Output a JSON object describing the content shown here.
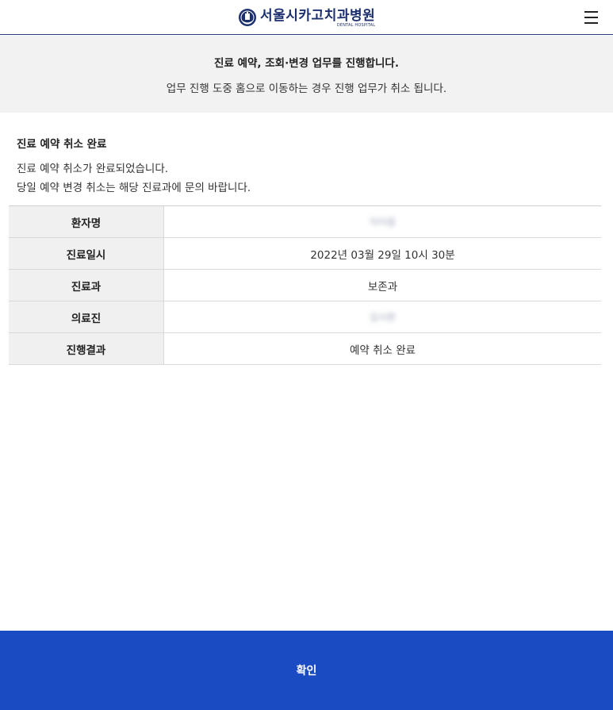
{
  "header": {
    "hospital_name": "서울시카고치과병원",
    "hospital_sub": "DENTAL HOSPITAL",
    "menu_icon": "hamburger-menu-icon"
  },
  "notice": {
    "title": "진료 예약, 조회·변경 업무를 진행합니다.",
    "subtitle": "업무 진행 도중 홈으로 이동하는 경우 진행 업무가 취소 됩니다."
  },
  "result": {
    "section_title": "진료 예약 취소 완료",
    "message_line1": "진료 예약 취소가 완료되었습니다.",
    "message_line2": "당일 예약 변경 취소는 해당 진료과에 문의 바랍니다."
  },
  "table": {
    "rows": [
      {
        "label": "환자명",
        "value": "이이응"
      },
      {
        "label": "진료일시",
        "value": "2022년 03월 29일 10시 30분"
      },
      {
        "label": "진료과",
        "value": "보존과"
      },
      {
        "label": "의료진",
        "value": "김시완"
      },
      {
        "label": "진행결과",
        "value": "예약 취소 완료"
      }
    ]
  },
  "footer": {
    "confirm_label": "확인"
  },
  "colors": {
    "brand_navy": "#1c2f6e",
    "confirm_button": "#1b4bc3",
    "notice_bg": "#f2f2f2",
    "table_header_bg": "#f0f0f0"
  }
}
